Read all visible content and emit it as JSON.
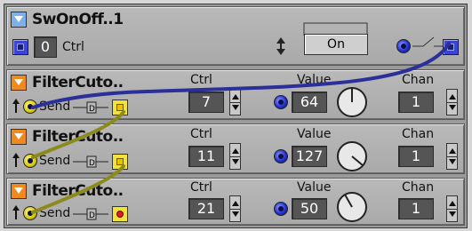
{
  "modules": [
    {
      "title": "SwOnOff..1",
      "value": "0",
      "ctrl_label": "Ctrl",
      "state_label": "On"
    },
    {
      "title": "FilterCuto..",
      "send_label": "Send",
      "ctrl_label": "Ctrl",
      "ctrl_value": "7",
      "value_label": "Value",
      "value": "64",
      "chan_label": "Chan",
      "chan_value": "1"
    },
    {
      "title": "FilterCuto..",
      "send_label": "Send",
      "ctrl_label": "Ctrl",
      "ctrl_value": "11",
      "value_label": "Value",
      "value": "127",
      "chan_label": "Chan",
      "chan_value": "1"
    },
    {
      "title": "FilterCuto..",
      "send_label": "Send",
      "ctrl_label": "Ctrl",
      "ctrl_value": "21",
      "value_label": "Value",
      "value": "50",
      "chan_label": "Chan",
      "chan_value": "1"
    }
  ],
  "colors": {
    "panel": "#b0b0b0",
    "accent_blue": "#3b44d8",
    "cable_blue": "#2a2f9a",
    "cable_olive": "#8c8a1a",
    "port_yellow": "#f2e23a",
    "collapse_orange": "#f08a1e"
  }
}
